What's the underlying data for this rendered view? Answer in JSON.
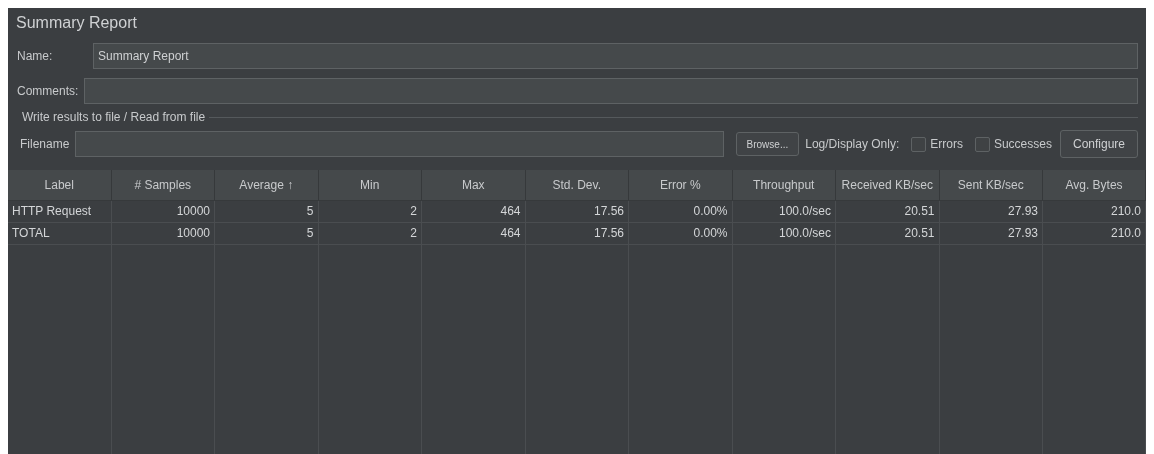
{
  "title": "Summary Report",
  "name": {
    "label": "Name:",
    "value": "Summary Report"
  },
  "comments": {
    "label": "Comments:"
  },
  "file_group": {
    "legend": "Write results to file / Read from file",
    "filename_label": "Filename",
    "browse": "Browse...",
    "log_label": "Log/Display Only:",
    "checkboxes": [
      {
        "label": "Errors",
        "checked": false
      },
      {
        "label": "Successes",
        "checked": false
      }
    ],
    "configure": "Configure"
  },
  "table": {
    "columns": [
      "Label",
      "# Samples",
      "Average ↑",
      "Min",
      "Max",
      "Std. Dev.",
      "Error %",
      "Throughput",
      "Received KB/sec",
      "Sent KB/sec",
      "Avg. Bytes"
    ],
    "rows": [
      [
        "HTTP Request",
        "10000",
        "5",
        "2",
        "464",
        "17.56",
        "0.00%",
        "100.0/sec",
        "20.51",
        "27.93",
        "210.0"
      ],
      [
        "TOTAL",
        "10000",
        "5",
        "2",
        "464",
        "17.56",
        "0.00%",
        "100.0/sec",
        "20.51",
        "27.93",
        "210.0"
      ]
    ]
  }
}
